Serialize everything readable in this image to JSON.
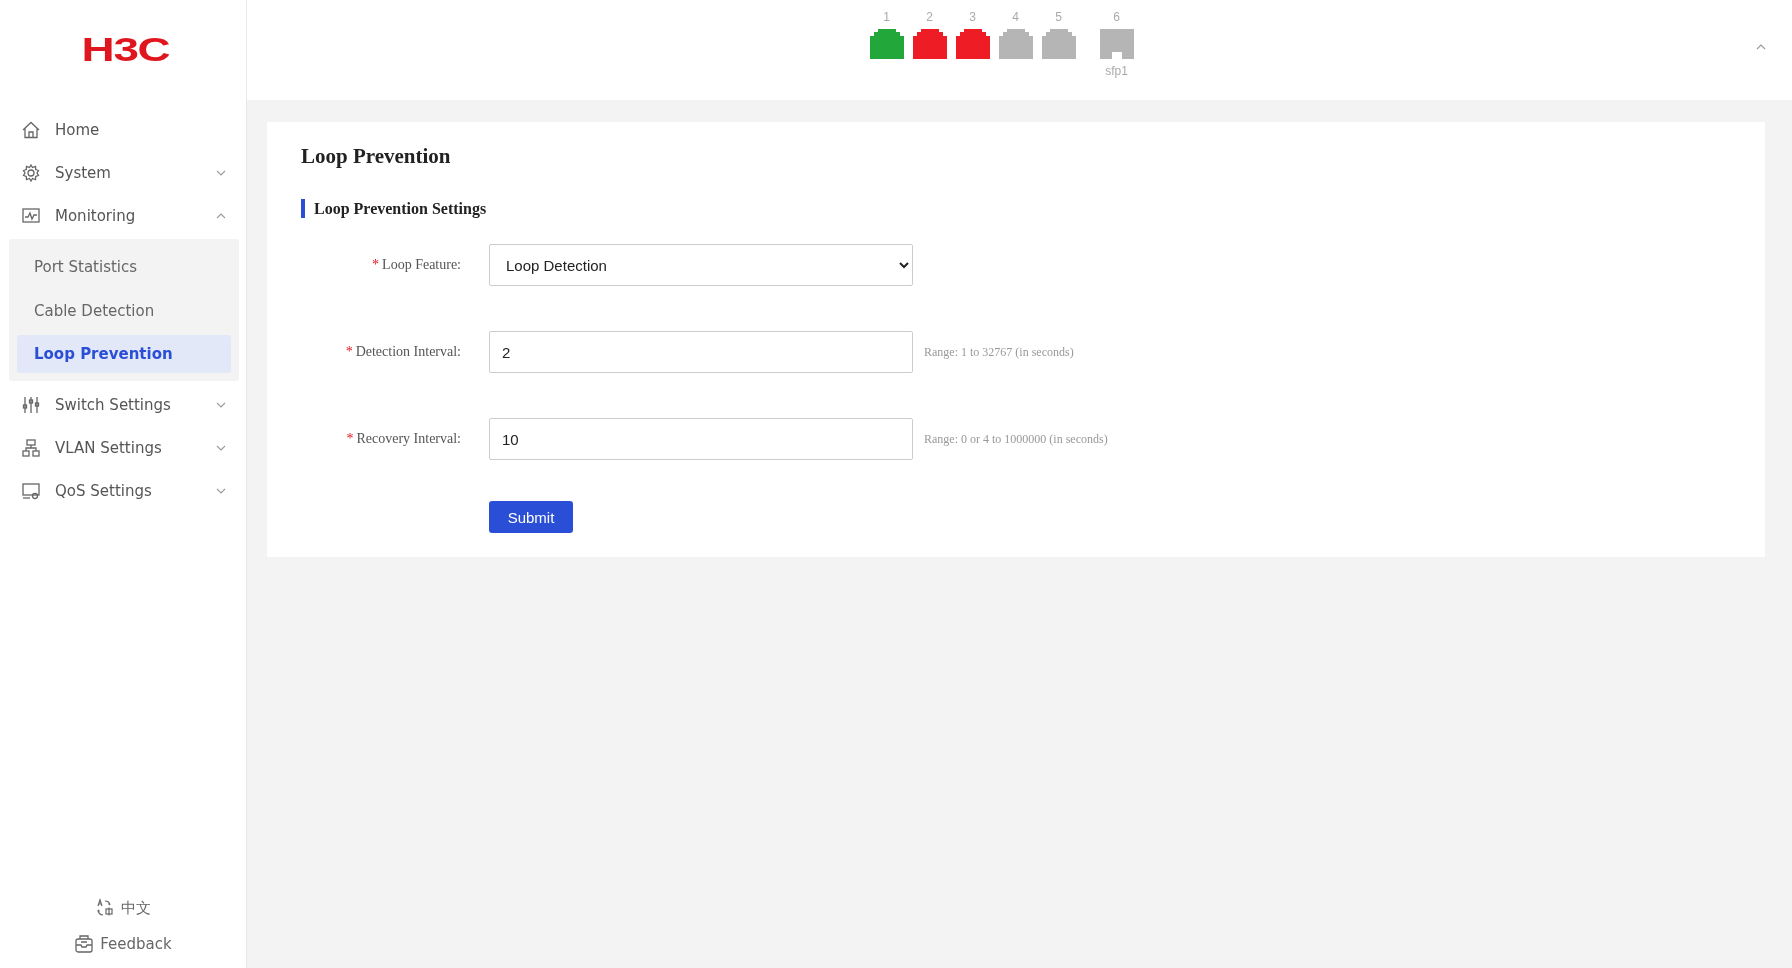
{
  "logo": {
    "text": "H3C"
  },
  "sidebar": {
    "items": [
      {
        "label": "Home"
      },
      {
        "label": "System",
        "expanded": false
      },
      {
        "label": "Monitoring",
        "expanded": true,
        "children": [
          {
            "label": "Port Statistics",
            "selected": false
          },
          {
            "label": "Cable Detection",
            "selected": false
          },
          {
            "label": "Loop Prevention",
            "selected": true
          }
        ]
      },
      {
        "label": "Switch Settings",
        "expanded": false
      },
      {
        "label": "VLAN Settings",
        "expanded": false
      },
      {
        "label": "QoS Settings",
        "expanded": false
      }
    ],
    "language": "中文",
    "feedback": "Feedback"
  },
  "ports": [
    {
      "number": "1",
      "kind": "rj45",
      "color": "#22a83a"
    },
    {
      "number": "2",
      "kind": "rj45",
      "color": "#ee1c25"
    },
    {
      "number": "3",
      "kind": "rj45",
      "color": "#ee1c25"
    },
    {
      "number": "4",
      "kind": "rj45",
      "color": "#b5b5b5"
    },
    {
      "number": "5",
      "kind": "rj45",
      "color": "#b5b5b5"
    },
    {
      "number": "6",
      "kind": "sfp",
      "color": "#b5b5b5",
      "label": "sfp1"
    }
  ],
  "page": {
    "title": "Loop Prevention",
    "section": "Loop Prevention Settings",
    "fields": [
      {
        "label": "Loop Feature:",
        "required_mark": "*",
        "kind": "select",
        "value": "Loop Detection"
      },
      {
        "label": "Detection Interval:",
        "required_mark": "*",
        "kind": "input",
        "value": "2",
        "hint": "Range: 1 to 32767 (in seconds)"
      },
      {
        "label": "Recovery Interval:",
        "required_mark": "*",
        "kind": "input",
        "value": "10",
        "hint": "Range: 0 or 4 to 1000000 (in seconds)"
      }
    ],
    "submit": "Submit"
  }
}
